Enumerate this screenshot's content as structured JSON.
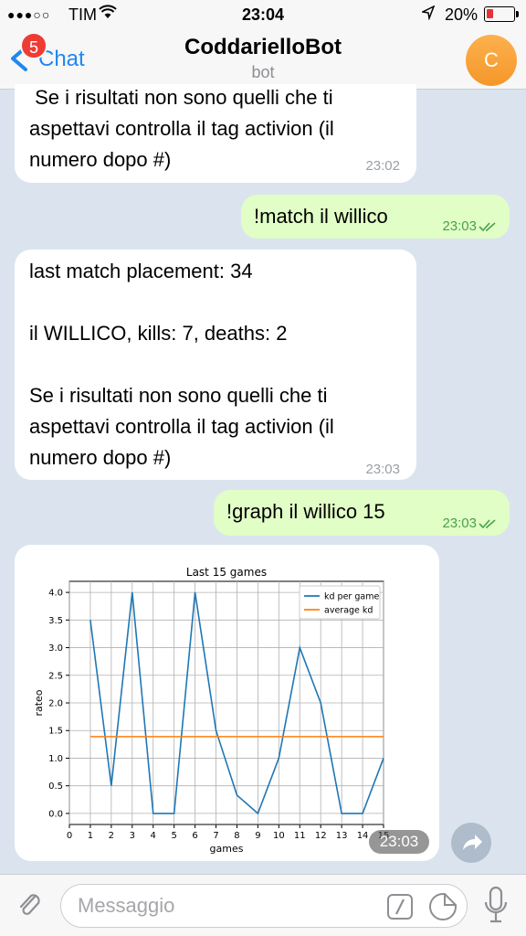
{
  "status": {
    "signal": "●●●○○",
    "carrier": "TIM",
    "time": "23:04",
    "battery": "20%",
    "battery_color": "#e8323a"
  },
  "nav": {
    "back_label": "Chat",
    "unread_badge": "5",
    "title": "CoddarielloBot",
    "subtitle": "bot",
    "avatar_letter": "C",
    "accent": "#1e87f0"
  },
  "messages": [
    {
      "direction": "incoming",
      "text": " Se i risultati non sono quelli che ti\naspettavi controlla il tag activion (il\nnumero dopo #)",
      "time": "23:02"
    },
    {
      "direction": "outgoing",
      "text": "!match il willico",
      "time": "23:03",
      "read": true
    },
    {
      "direction": "incoming",
      "text": "last match placement: 34\n\nil WILLICO, kills: 7, deaths: 2\n\nSe i risultati non sono quelli che ti\naspettavi controlla il tag activion (il\nnumero dopo #)",
      "time": "23:03"
    },
    {
      "direction": "outgoing",
      "text": "!graph il willico 15",
      "time": "23:03",
      "read": true
    },
    {
      "direction": "incoming",
      "type": "image",
      "time": "23:03"
    }
  ],
  "chart_data": {
    "type": "line",
    "title": "Last 15 games",
    "xlabel": "games",
    "ylabel": "rateo",
    "xlim": [
      0,
      15
    ],
    "ylim": [
      -0.2,
      4.2
    ],
    "xticks": [
      0,
      1,
      2,
      3,
      4,
      5,
      6,
      7,
      8,
      9,
      10,
      11,
      12,
      13,
      14,
      15
    ],
    "yticks": [
      "0.0",
      "0.5",
      "1.0",
      "1.5",
      "2.0",
      "2.5",
      "3.0",
      "3.5",
      "4.0"
    ],
    "grid": true,
    "legend_position": "top-right",
    "series": [
      {
        "name": "kd per game",
        "color": "#1f77b4",
        "x": [
          1,
          2,
          3,
          4,
          5,
          6,
          7,
          8,
          9,
          10,
          11,
          12,
          13,
          14,
          15
        ],
        "values": [
          3.5,
          0.5,
          4.0,
          0.0,
          0.0,
          4.0,
          1.5,
          0.33,
          0.0,
          1.0,
          3.0,
          2.0,
          0.0,
          0.0,
          1.0
        ]
      },
      {
        "name": "average kd",
        "color": "#ff7f0e",
        "x": [
          1,
          15
        ],
        "values": [
          1.39,
          1.39
        ]
      }
    ]
  },
  "input": {
    "placeholder": "Messaggio",
    "value": ""
  },
  "colors": {
    "incoming_bubble": "#ffffff",
    "outgoing_bubble": "#e1fec6",
    "read_ticks": "#4aa04a"
  },
  "icons": {
    "attach": "paperclip-icon",
    "commands": "slash-command-icon",
    "sticker": "sticker-icon",
    "mic": "microphone-icon",
    "share": "share-arrow-icon",
    "back": "chevron-left-icon"
  }
}
